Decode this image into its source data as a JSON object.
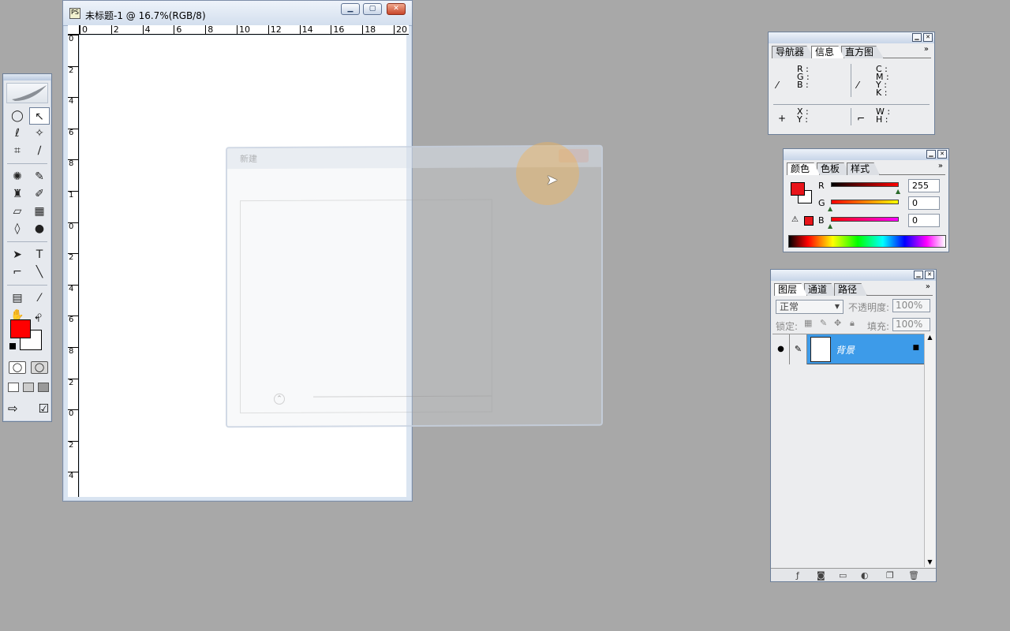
{
  "document": {
    "title": "未标题-1 @ 16.7%(RGB/8)",
    "ruler_h": [
      "0",
      "2",
      "4",
      "6",
      "8",
      "10",
      "12",
      "14",
      "16",
      "18",
      "20"
    ],
    "ruler_v": [
      "0",
      "2",
      "4",
      "6",
      "8",
      "1",
      "0",
      "2",
      "4",
      "6",
      "8",
      "2",
      "0",
      "2",
      "4",
      "6",
      "8",
      "2",
      "8"
    ]
  },
  "dialog": {
    "title": "新建"
  },
  "info_panel": {
    "tabs": [
      "导航器",
      "信息",
      "直方图"
    ],
    "active_tab": 1,
    "rgb_labels": [
      "R :",
      "G :",
      "B :"
    ],
    "cmyk_labels": [
      "C :",
      "M :",
      "Y :",
      "K :"
    ],
    "xy_labels": [
      "X :",
      "Y :"
    ],
    "wh_labels": [
      "W :",
      "H :"
    ]
  },
  "color_panel": {
    "tabs": [
      "颜色",
      "色板",
      "样式"
    ],
    "active_tab": 0,
    "sliders": [
      {
        "label": "R",
        "value": "255",
        "gradient": "linear-gradient(90deg,#000,#f00)",
        "pos": 1.0
      },
      {
        "label": "G",
        "value": "0",
        "gradient": "linear-gradient(90deg,#f00,#ff0)",
        "pos": 0.0
      },
      {
        "label": "B",
        "value": "0",
        "gradient": "linear-gradient(90deg,#f00,#f0f)",
        "pos": 0.0
      }
    ],
    "foreground": "#e8141a"
  },
  "layers_panel": {
    "tabs": [
      "图层",
      "通道",
      "路径"
    ],
    "active_tab": 0,
    "blend_mode": "正常",
    "opacity_label": "不透明度:",
    "opacity_value": "100%",
    "lock_label": "锁定:",
    "fill_label": "填充:",
    "fill_value": "100%",
    "layers": [
      {
        "name": "背景"
      }
    ]
  },
  "toolbox": {
    "foreground": "#ff0000",
    "background": "#ffffff"
  }
}
